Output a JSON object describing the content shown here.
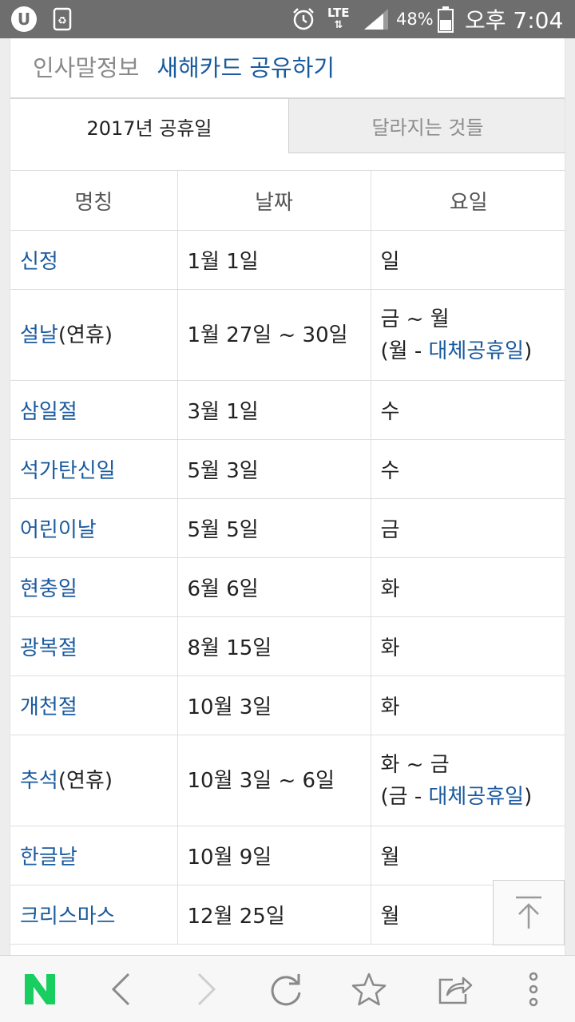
{
  "status_bar": {
    "network": "LTE",
    "battery": "48%",
    "time": "오후 7:04"
  },
  "breadcrumb": {
    "parent": "인사말정보",
    "current": "새해카드 공유하기"
  },
  "tabs": [
    {
      "label": "2017년 공휴일",
      "active": true
    },
    {
      "label": "달라지는 것들",
      "active": false
    }
  ],
  "table": {
    "headers": [
      "명칭",
      "날짜",
      "요일"
    ],
    "rows": [
      {
        "name": "신정",
        "name_suffix": "",
        "date": "1월 1일",
        "day": "일",
        "note_open": "",
        "note_link": "",
        "note_close": ""
      },
      {
        "name": "설날",
        "name_suffix": "(연휴)",
        "date": "1월 27일 ~ 30일",
        "day": "금 ~ 월",
        "note_open": "(월 - ",
        "note_link": "대체공휴일",
        "note_close": ")"
      },
      {
        "name": "삼일절",
        "name_suffix": "",
        "date": "3월 1일",
        "day": "수",
        "note_open": "",
        "note_link": "",
        "note_close": ""
      },
      {
        "name": "석가탄신일",
        "name_suffix": "",
        "date": "5월 3일",
        "day": "수",
        "note_open": "",
        "note_link": "",
        "note_close": ""
      },
      {
        "name": "어린이날",
        "name_suffix": "",
        "date": "5월 5일",
        "day": "금",
        "note_open": "",
        "note_link": "",
        "note_close": ""
      },
      {
        "name": "현충일",
        "name_suffix": "",
        "date": "6월 6일",
        "day": "화",
        "note_open": "",
        "note_link": "",
        "note_close": ""
      },
      {
        "name": "광복절",
        "name_suffix": "",
        "date": "8월 15일",
        "day": "화",
        "note_open": "",
        "note_link": "",
        "note_close": ""
      },
      {
        "name": "개천절",
        "name_suffix": "",
        "date": "10월 3일",
        "day": "화",
        "note_open": "",
        "note_link": "",
        "note_close": ""
      },
      {
        "name": "추석",
        "name_suffix": "(연휴)",
        "date": "10월 3일 ~ 6일",
        "day": "화 ~ 금",
        "note_open": "(금 - ",
        "note_link": "대체공휴일",
        "note_close": ")"
      },
      {
        "name": "한글날",
        "name_suffix": "",
        "date": "10월 9일",
        "day": "월",
        "note_open": "",
        "note_link": "",
        "note_close": ""
      },
      {
        "name": "크리스마스",
        "name_suffix": "",
        "date": "12월 25일",
        "day": "월",
        "note_open": "",
        "note_link": "",
        "note_close": ""
      }
    ]
  },
  "bottom_nav": {
    "logo_letter": "N",
    "icons": [
      "naver-logo-icon",
      "back-icon",
      "forward-icon",
      "refresh-icon",
      "bookmark-star-icon",
      "share-icon",
      "more-menu-icon"
    ]
  },
  "colors": {
    "link": "#1a5a9e",
    "naver_green": "#19ce60",
    "status_bar": "#6e6e6e"
  }
}
